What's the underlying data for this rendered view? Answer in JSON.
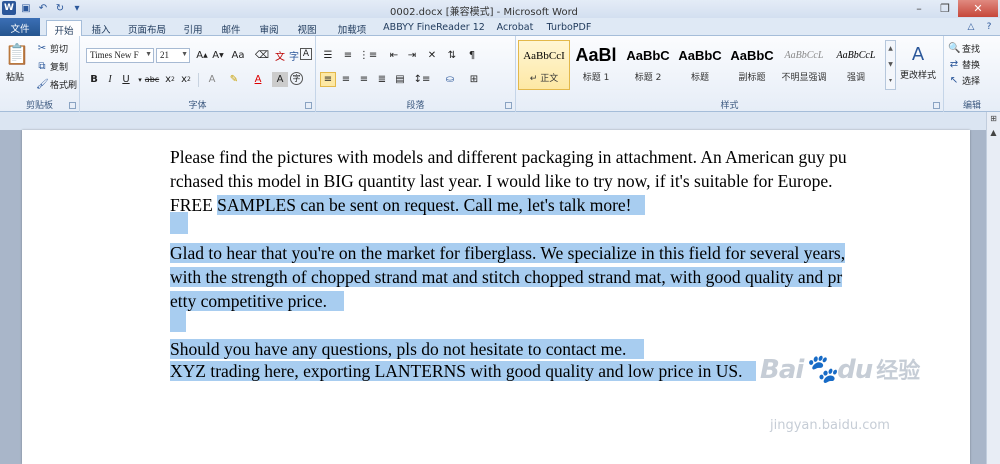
{
  "window": {
    "title": "0002.docx [兼容模式] - Microsoft Word"
  },
  "tabs": [
    "文件",
    "开始",
    "插入",
    "页面布局",
    "引用",
    "邮件",
    "审阅",
    "视图",
    "加载项",
    "ABBYY FineReader 12",
    "Acrobat",
    "TurboPDF"
  ],
  "clipboard": {
    "paste": "粘贴",
    "cut": "剪切",
    "copy": "复制",
    "format_painter": "格式刷",
    "label": "剪贴板"
  },
  "font": {
    "name": "Times New F",
    "size": "21",
    "label": "字体"
  },
  "paragraph": {
    "label": "段落"
  },
  "styles": {
    "label": "样式",
    "items": [
      {
        "sample": "AaBbCcI",
        "name": "↵ 正文"
      },
      {
        "sample": "AaBl",
        "name": "标题 1"
      },
      {
        "sample": "AaBbC",
        "name": "标题 2"
      },
      {
        "sample": "AaBbC",
        "name": "标题"
      },
      {
        "sample": "AaBbC",
        "name": "副标题"
      },
      {
        "sample": "AaBbCcL",
        "name": "不明显强调"
      },
      {
        "sample": "AaBbCcL",
        "name": "强调"
      }
    ],
    "change_styles": "更改样式"
  },
  "editing": {
    "find": "查找",
    "replace": "替换",
    "select": "选择",
    "label": "编辑"
  },
  "document": {
    "lines": [
      "Please find the pictures with models and different packaging in attachment. An American guy pu",
      "rchased this model in BIG quantity last year. I would like to try now, if it's suitable for Europe.",
      "FREE ",
      "SAMPLES can be sent on request. Call me, let's talk more!",
      "Glad to hear that you're on the market for fiberglass. We specialize in this field for several years,",
      " with the strength of chopped strand mat and stitch chopped strand mat, with good quality and pr",
      "etty competitive price.",
      "Should you have any questions, pls do not hesitate to contact me.",
      "XYZ trading here, exporting LANTERNS with good quality and low price in US."
    ]
  },
  "watermark": {
    "brand": "Bai",
    "brand2": "du",
    "cn": "经验",
    "url": "jingyan.baidu.com"
  }
}
